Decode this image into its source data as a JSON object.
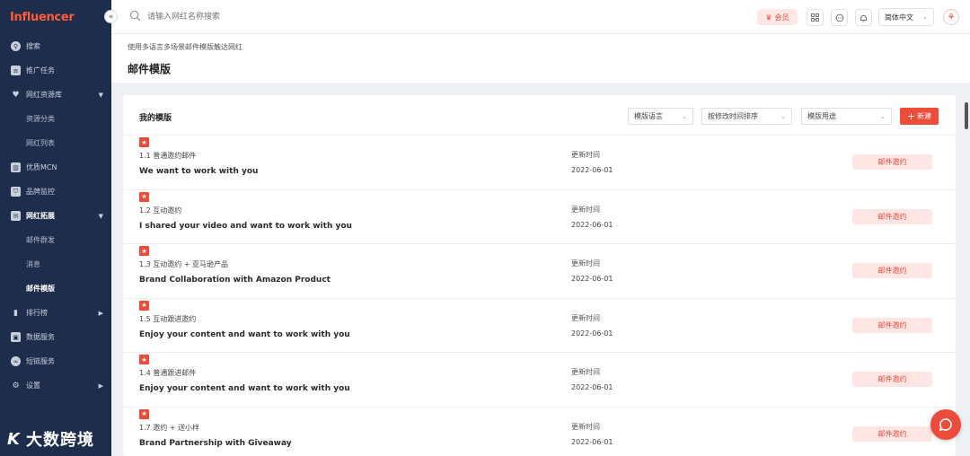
{
  "sidebar": {
    "logo": "Influencer",
    "collapse_label": "«",
    "items": [
      {
        "label": "搜索",
        "icon": "search-circle-icon"
      },
      {
        "label": "推广任务",
        "icon": "document-icon"
      },
      {
        "label": "网红资源库",
        "icon": "heart-icon",
        "arrow": "▼"
      },
      {
        "label": "资源分类",
        "sub": true
      },
      {
        "label": "网红列表",
        "sub": true
      },
      {
        "label": "优质MCN",
        "icon": "building-icon"
      },
      {
        "label": "品牌监控",
        "icon": "shield-icon"
      },
      {
        "label": "网红拓展",
        "icon": "mail-icon",
        "arrow": "▼",
        "open": true
      },
      {
        "label": "邮件群发",
        "sub": true
      },
      {
        "label": "消息",
        "sub": true
      },
      {
        "label": "邮件模版",
        "sub": true,
        "active": true
      },
      {
        "label": "排行榜",
        "icon": "bar-chart-icon",
        "arrow": "▶"
      },
      {
        "label": "数据服务",
        "icon": "image-icon"
      },
      {
        "label": "短链服务",
        "icon": "link-icon"
      },
      {
        "label": "设置",
        "icon": "gear-icon",
        "arrow": "▶"
      }
    ]
  },
  "watermark": {
    "k": "K",
    "text": "大数跨境"
  },
  "topbar": {
    "search_placeholder": "请输入网红名称搜索",
    "vip_label": "会员",
    "language": "简体中文"
  },
  "page": {
    "breadcrumb": "使用多语言多场景邮件模版触达网红",
    "title": "邮件模版"
  },
  "card": {
    "title": "我的模版",
    "filters": [
      "模版语言",
      "按修改时间排序",
      "模版用途"
    ],
    "new_label": "新建"
  },
  "templates": [
    {
      "sub": "1.1 普通邀约邮件",
      "title": "We want to work with you",
      "meta_label": "更新时间",
      "date": "2022-06-01",
      "action": "邮件邀约"
    },
    {
      "sub": "1.2 互动邀约",
      "title": "I shared your video and want to work with you",
      "meta_label": "更新时间",
      "date": "2022-06-01",
      "action": "邮件邀约"
    },
    {
      "sub": "1.3 互动邀约 + 亚马逊产品",
      "title": "Brand Collaboration with Amazon Product",
      "meta_label": "更新时间",
      "date": "2022-06-01",
      "action": "邮件邀约"
    },
    {
      "sub": "1.5 互动跟进邀约",
      "title": "Enjoy your content and want to work with you",
      "meta_label": "更新时间",
      "date": "2022-06-01",
      "action": "邮件邀约"
    },
    {
      "sub": "1.4 普通跟进邮件",
      "title": "Enjoy your content and want to work with you",
      "meta_label": "更新时间",
      "date": "2022-06-01",
      "action": "邮件邀约"
    },
    {
      "sub": "1.7 邀约 + 送小样",
      "title": "Brand Partnership with Giveaway",
      "meta_label": "更新时间",
      "date": "2022-06-01",
      "action": "邮件邀约"
    }
  ],
  "colors": {
    "accent": "#ee4c3a",
    "sidebar_bg": "#1f2d4d"
  }
}
